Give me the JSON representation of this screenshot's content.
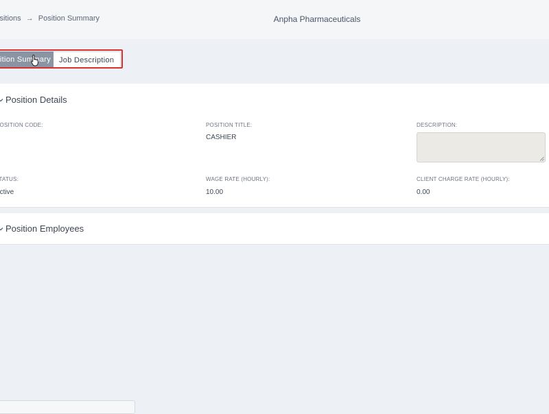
{
  "breadcrumb": {
    "parent": "Positions",
    "arrow": "→",
    "current": "Position Summary"
  },
  "header": {
    "company": "Anpha Pharmaceuticals"
  },
  "tabs": [
    {
      "label": "Position Summary",
      "active": true
    },
    {
      "label": "Job Description",
      "active": false
    }
  ],
  "details": {
    "title": "Position Details",
    "fields": {
      "position_code": {
        "label": "POSITION CODE:",
        "value": ""
      },
      "position_title": {
        "label": "POSITION TITLE:",
        "value": "CASHIER"
      },
      "description": {
        "label": "DESCRIPTION:",
        "value": ""
      },
      "status": {
        "label": "STATUS:",
        "value": "Active"
      },
      "wage_rate": {
        "label": "WAGE RATE (HOURLY):",
        "value": "10.00"
      },
      "client_charge_rate": {
        "label": "CLIENT CHARGE RATE (HOURLY):",
        "value": "0.00"
      }
    }
  },
  "employees": {
    "title": "Position Employees"
  },
  "colors": {
    "highlight": "#d9312f",
    "active_tab": "#8a94a3",
    "page_bg": "#edf0f4"
  },
  "icons": {
    "breadcrumb_arrow": "arrow-right-icon",
    "details_toggle": "chevron-down-icon",
    "employees_toggle": "chevron-down-icon",
    "cursor": "hand-pointer-icon"
  }
}
